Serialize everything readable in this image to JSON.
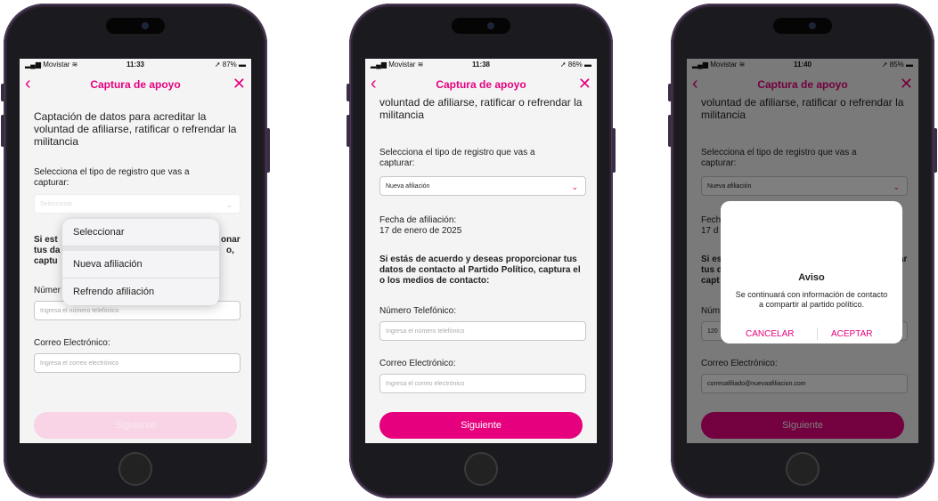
{
  "status_bar": {
    "carrier": "Movistar",
    "times": [
      "11:33",
      "11:38",
      "11:40"
    ],
    "batteries": [
      "87%",
      "86%",
      "85%"
    ]
  },
  "nav": {
    "title": "Captura de apoyo",
    "back_icon": "chevron-left-icon",
    "close_icon": "close-icon"
  },
  "colors": {
    "accent": "#e6007e",
    "accent_disabled": "#f8d4e6",
    "background": "#f4f4f5"
  },
  "form": {
    "heading": "Captación de datos para acreditar la voluntad de afiliarse, ratificar o refrendar la militancia",
    "heading_partial": "voluntad de afiliarse, ratificar o refrendar la militancia",
    "registration_type_label": "Selecciona el tipo de registro que vas a capturar:",
    "select_placeholder": "Seleccionar",
    "selected_value": "Nueva afiliación",
    "affiliation_date_label": "Fecha de afiliación:",
    "affiliation_date_value": "17 de enero de 2025",
    "contact_consent": "Si estás de acuerdo y deseas proporcionar tus datos de contacto al Partido Político, captura el o los medios de contacto:",
    "phone_label": "Número Telefónico:",
    "phone_placeholder": "Ingresa el número telefónico",
    "phone_value_partial": "120",
    "email_label": "Correo Electrónico:",
    "email_placeholder": "Ingresa el correo electrónico",
    "email_value": "correoafiliado@nuevaafiliacion.com",
    "next_button": "Siguiente"
  },
  "screen1": {
    "dropdown_options": [
      "Seleccionar",
      "Nueva afiliación",
      "Refrendo afiliación"
    ],
    "partial_consent_line1": "Si est",
    "partial_consent_right1": "onar",
    "partial_consent_line2": "tus da",
    "partial_consent_right2": "o,",
    "partial_consent_line3": "captu",
    "partial_phone_label": "Númer"
  },
  "screen3": {
    "partial_date_label": "Fech",
    "partial_date_value": "17 d",
    "partial_consent_line1": "Si es",
    "partial_consent_right1": "ar",
    "partial_consent_line2": "tus d",
    "partial_consent_line3": "capt",
    "partial_phone_label": "Núm"
  },
  "alert": {
    "title": "Aviso",
    "message": "Se continuará con información de contacto a compartir al partido político.",
    "cancel": "CANCELAR",
    "accept": "ACEPTAR"
  }
}
